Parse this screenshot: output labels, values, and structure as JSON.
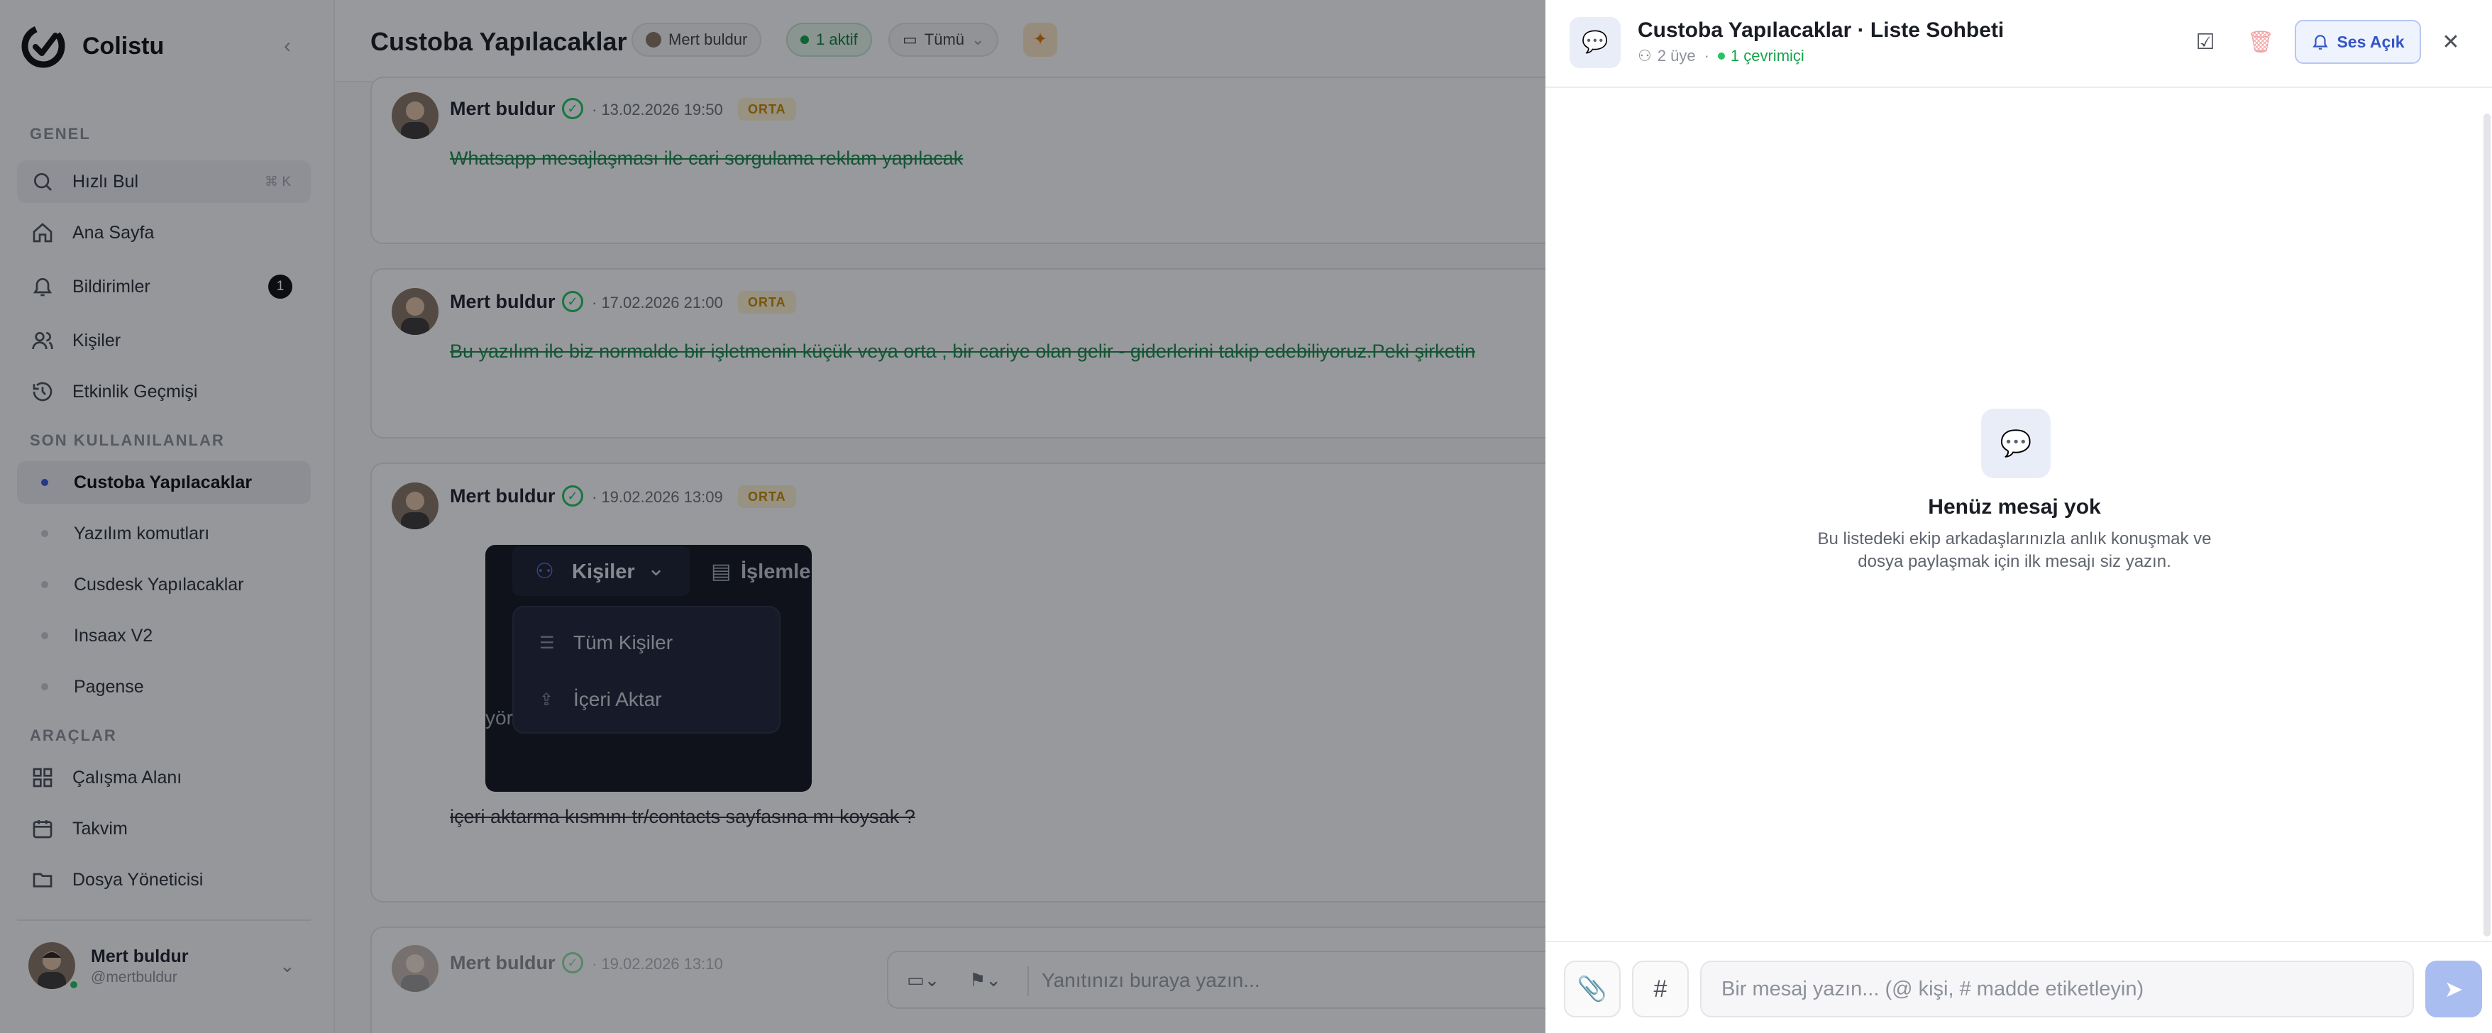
{
  "sidebar": {
    "brand": "Colistu",
    "sections": {
      "general": "GENEL",
      "recent": "SON KULLANILANLAR",
      "tools": "ARAÇLAR"
    },
    "search": {
      "label": "Hızlı Bul",
      "shortcut": "⌘ K"
    },
    "general_items": [
      {
        "label": "Ana Sayfa"
      },
      {
        "label": "Bildirimler",
        "badge": "1"
      },
      {
        "label": "Kişiler"
      },
      {
        "label": "Etkinlik Geçmişi"
      }
    ],
    "recent_items": [
      {
        "label": "Custoba Yapılacaklar"
      },
      {
        "label": "Yazılım komutları"
      },
      {
        "label": "Cusdesk Yapılacaklar"
      },
      {
        "label": "Insaax V2"
      },
      {
        "label": "Pagense"
      }
    ],
    "tool_items": [
      {
        "label": "Çalışma Alanı"
      },
      {
        "label": "Takvim"
      },
      {
        "label": "Dosya Yöneticisi"
      }
    ],
    "user": {
      "name": "Mert buldur",
      "handle": "@mertbuldur"
    }
  },
  "main": {
    "title": "Custoba Yapılacaklar",
    "owner_pill": "Mert buldur",
    "active_pill": "1 aktif",
    "filter_pill": "Tümü",
    "items": [
      {
        "author": "Mert buldur",
        "date": "· 13.02.2026 19:50",
        "priority": "ORTA",
        "text": "Whatsapp mesajlaşması ile cari sorgulama reklam yapılacak"
      },
      {
        "author": "Mert buldur",
        "date": "· 17.02.2026 21:00",
        "priority": "ORTA",
        "text": "Bu yazılım ile biz normalde bir işletmenin küçük veya orta , bir cariye olan gelir - giderlerini takip edebiliyoruz.Peki şirketin"
      },
      {
        "author": "Mert buldur",
        "date": "· 19.02.2026 13:09",
        "priority": "ORTA",
        "text": "içeri aktarma kısmını tr/contacts sayfasına mı koysak ?"
      },
      {
        "author": "Mert buldur",
        "date": "· 19.02.2026 13:10"
      }
    ],
    "screenshot": {
      "tab1": "Kişiler",
      "tab2": "İşlemle",
      "menu1": "Tüm Kişiler",
      "menu2": "İçeri Aktar",
      "fragment": "yör"
    },
    "composer_placeholder": "Yanıtınızı buraya yazın..."
  },
  "chat": {
    "title": "Custoba Yapılacaklar · Liste Sohbeti",
    "members": "2 üye",
    "online": "1 çevrimiçi",
    "sound_label": "Ses Açık",
    "empty_title": "Henüz mesaj yok",
    "empty_desc": "Bu listedeki ekip arkadaşlarınızla anlık konuşmak ve dosya paylaşmak için ilk mesajı siz yazın.",
    "input_placeholder": "Bir mesaj yazın... (@ kişi, # madde etiketleyin)"
  },
  "colors": {
    "accent": "#3b5bdb",
    "success": "#16a34a",
    "priority": "#c98a04"
  }
}
